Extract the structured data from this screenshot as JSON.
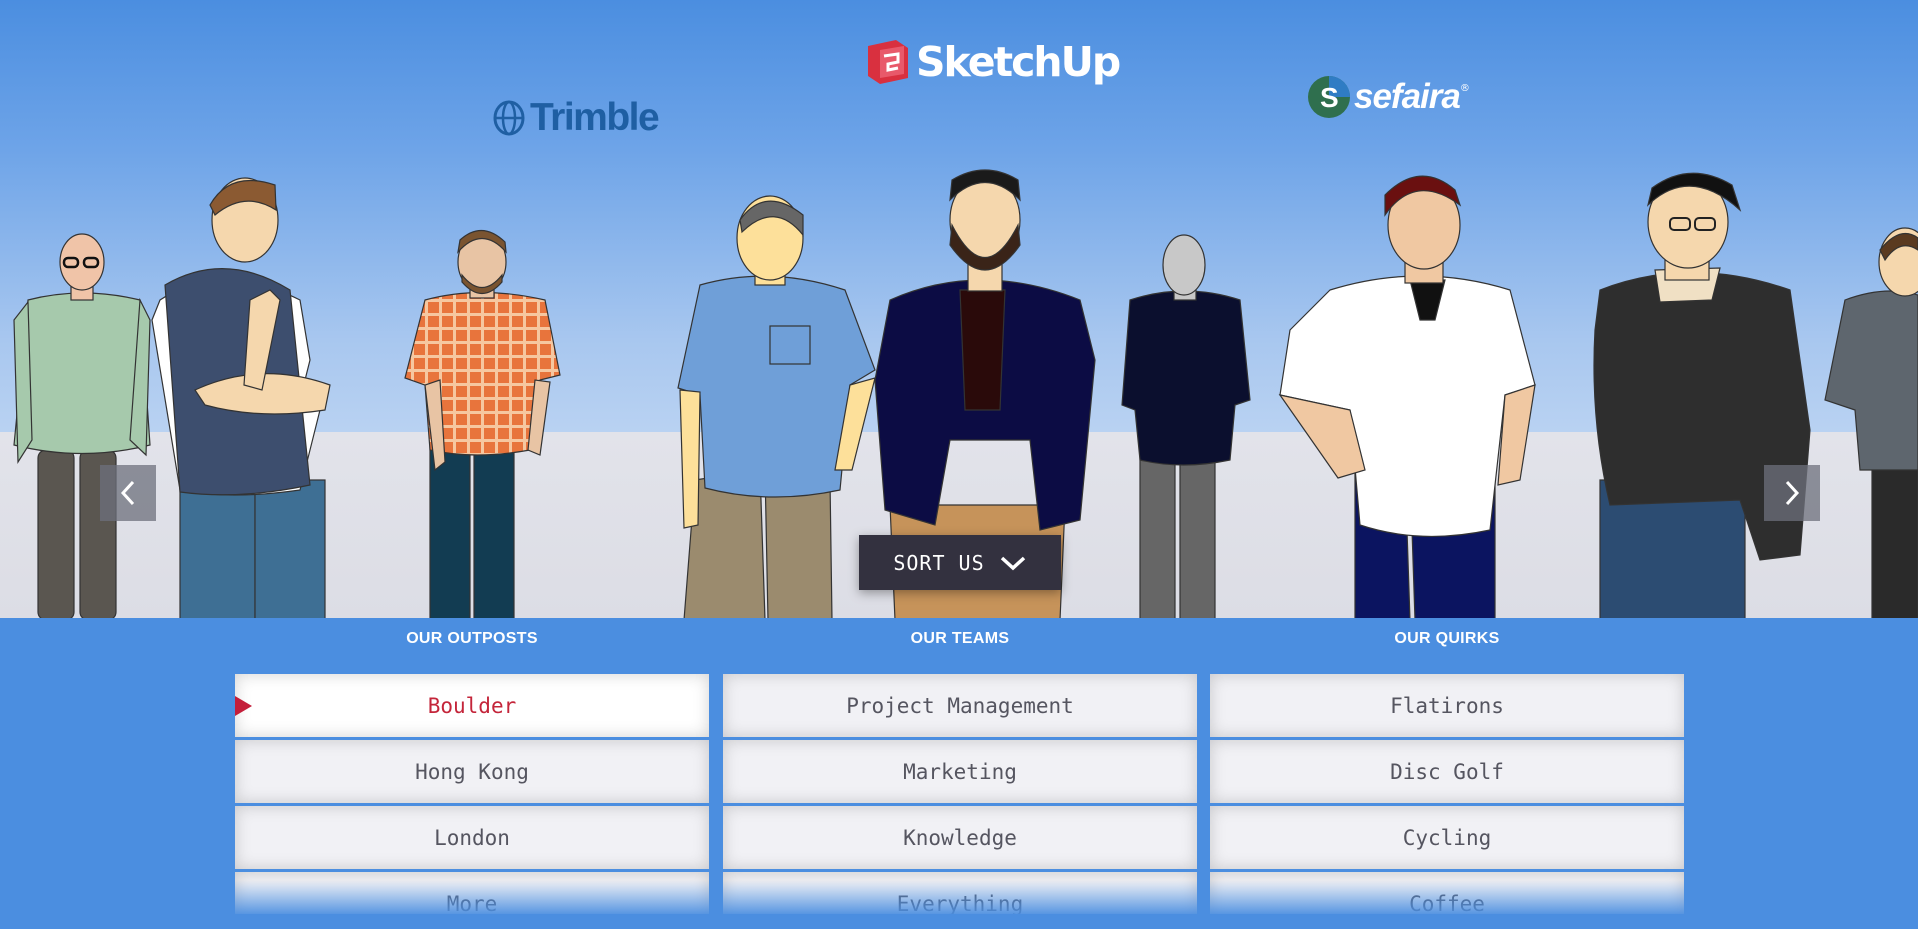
{
  "logos": {
    "trimble": "Trimble",
    "sketchup": "SketchUp",
    "sefaira": "sefaira",
    "registered_mark": "®"
  },
  "carousel": {
    "prev_icon": "chevron-left-icon",
    "next_icon": "chevron-right-icon"
  },
  "sort_button": {
    "label": "SORT US",
    "icon": "chevron-down-icon"
  },
  "filters": {
    "outposts": {
      "title": "OUR OUTPOSTS",
      "items": [
        "Boulder",
        "Hong Kong",
        "London",
        "More"
      ],
      "selected": "Boulder"
    },
    "teams": {
      "title": "OUR TEAMS",
      "items": [
        "Project Management",
        "Marketing",
        "Knowledge",
        "Everything"
      ]
    },
    "quirks": {
      "title": "OUR QUIRKS",
      "items": [
        "Flatirons",
        "Disc Golf",
        "Cycling",
        "Coffee"
      ]
    }
  },
  "colors": {
    "background_blue": "#4b8ee0",
    "selected_text": "#c4253a",
    "sort_button_bg": "#33313f"
  }
}
